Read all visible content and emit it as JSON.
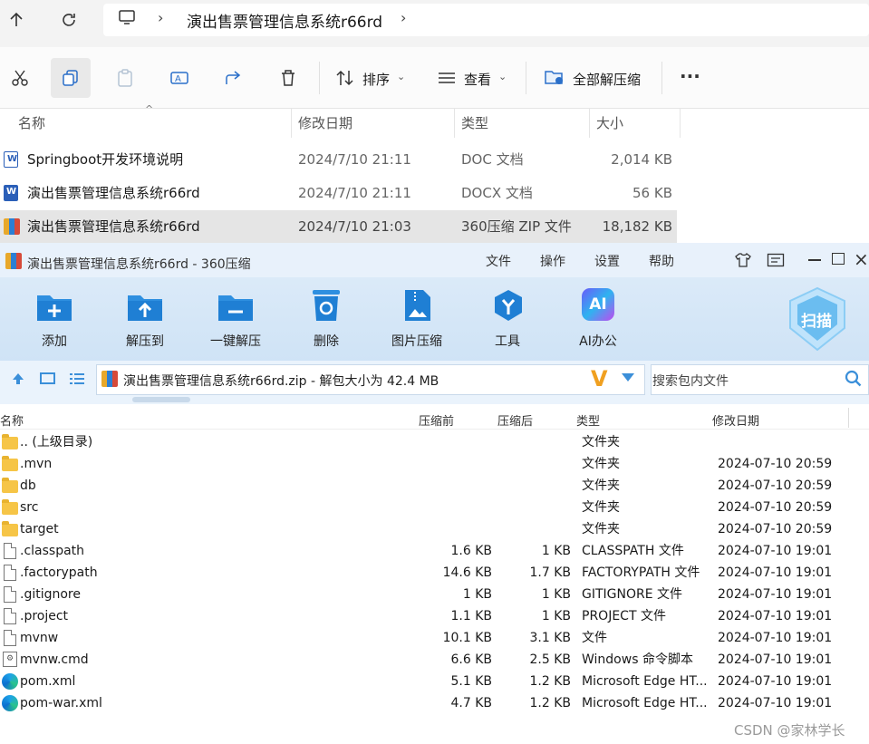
{
  "explorer": {
    "breadcrumb": "演出售票管理信息系统r66rd",
    "toolbar": {
      "sort": "排序",
      "view": "查看",
      "extract_all": "全部解压缩",
      "more": "···"
    },
    "columns": {
      "name": "名称",
      "modified": "修改日期",
      "type": "类型",
      "size": "大小"
    },
    "files": [
      {
        "name": "Springboot开发环境说明",
        "modified": "2024/7/10 21:11",
        "type": "DOC 文档",
        "size": "2,014 KB"
      },
      {
        "name": "演出售票管理信息系统r66rd",
        "modified": "2024/7/10 21:11",
        "type": "DOCX 文档",
        "size": "56 KB"
      },
      {
        "name": "演出售票管理信息系统r66rd",
        "modified": "2024/7/10 21:03",
        "type": "360压缩 ZIP 文件",
        "size": "18,182 KB"
      }
    ]
  },
  "zip": {
    "title": "演出售票管理信息系统r66rd - 360压缩",
    "menu": [
      "文件",
      "操作",
      "设置",
      "帮助"
    ],
    "tools": [
      "添加",
      "解压到",
      "一键解压",
      "删除",
      "图片压缩",
      "工具",
      "AI办公"
    ],
    "scan": "扫描",
    "path": "演出售票管理信息系统r66rd.zip - 解包大小为 42.4 MB",
    "search_placeholder": "搜索包内文件",
    "columns": {
      "name": "名称",
      "before": "压缩前",
      "after": "压缩后",
      "type": "类型",
      "modified": "修改日期"
    },
    "rows": [
      {
        "icon": "folder",
        "name": ".. (上级目录)",
        "before": "",
        "after": "",
        "type": "文件夹",
        "modified": ""
      },
      {
        "icon": "folder",
        "name": ".mvn",
        "before": "",
        "after": "",
        "type": "文件夹",
        "modified": "2024-07-10 20:59"
      },
      {
        "icon": "folder",
        "name": "db",
        "before": "",
        "after": "",
        "type": "文件夹",
        "modified": "2024-07-10 20:59"
      },
      {
        "icon": "folder",
        "name": "src",
        "before": "",
        "after": "",
        "type": "文件夹",
        "modified": "2024-07-10 20:59"
      },
      {
        "icon": "folder",
        "name": "target",
        "before": "",
        "after": "",
        "type": "文件夹",
        "modified": "2024-07-10 20:59"
      },
      {
        "icon": "file",
        "name": ".classpath",
        "before": "1.6 KB",
        "after": "1 KB",
        "type": "CLASSPATH 文件",
        "modified": "2024-07-10 19:01"
      },
      {
        "icon": "file",
        "name": ".factorypath",
        "before": "14.6 KB",
        "after": "1.7 KB",
        "type": "FACTORYPATH 文件",
        "modified": "2024-07-10 19:01"
      },
      {
        "icon": "file",
        "name": ".gitignore",
        "before": "1 KB",
        "after": "1 KB",
        "type": "GITIGNORE 文件",
        "modified": "2024-07-10 19:01"
      },
      {
        "icon": "file",
        "name": ".project",
        "before": "1.1 KB",
        "after": "1 KB",
        "type": "PROJECT 文件",
        "modified": "2024-07-10 19:01"
      },
      {
        "icon": "file",
        "name": "mvnw",
        "before": "10.1 KB",
        "after": "3.1 KB",
        "type": "文件",
        "modified": "2024-07-10 19:01"
      },
      {
        "icon": "cmd",
        "name": "mvnw.cmd",
        "before": "6.6 KB",
        "after": "2.5 KB",
        "type": "Windows 命令脚本",
        "modified": "2024-07-10 19:01"
      },
      {
        "icon": "edge",
        "name": "pom.xml",
        "before": "5.1 KB",
        "after": "1.2 KB",
        "type": "Microsoft Edge HT...",
        "modified": "2024-07-10 19:01"
      },
      {
        "icon": "edge",
        "name": "pom-war.xml",
        "before": "4.7 KB",
        "after": "1.2 KB",
        "type": "Microsoft Edge HT...",
        "modified": "2024-07-10 19:01"
      }
    ]
  },
  "watermark": "CSDN @家林学长"
}
